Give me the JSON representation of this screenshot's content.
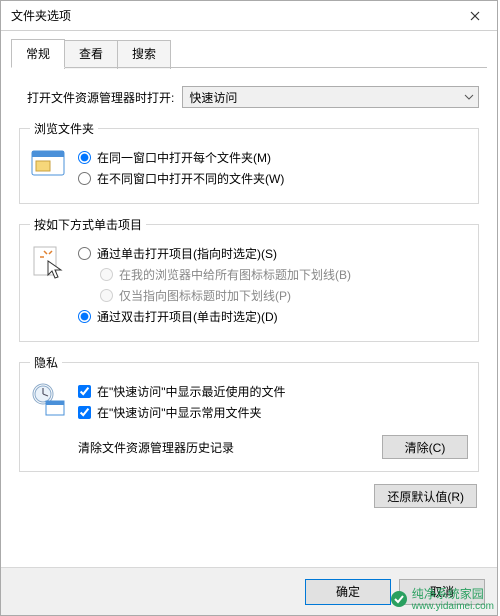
{
  "window": {
    "title": "文件夹选项"
  },
  "tabs": {
    "items": [
      "常规",
      "查看",
      "搜索"
    ],
    "active": 0
  },
  "open_row": {
    "label": "打开文件资源管理器时打开:",
    "value": "快速访问"
  },
  "browse_group": {
    "legend": "浏览文件夹",
    "opt1": "在同一窗口中打开每个文件夹(M)",
    "opt2": "在不同窗口中打开不同的文件夹(W)",
    "selected": 0
  },
  "click_group": {
    "legend": "按如下方式单击项目",
    "opt1": "通过单击打开项目(指向时选定)(S)",
    "opt1a": "在我的浏览器中给所有图标标题加下划线(B)",
    "opt1b": "仅当指向图标标题时加下划线(P)",
    "opt2": "通过双击打开项目(单击时选定)(D)",
    "selected": 1
  },
  "privacy_group": {
    "legend": "隐私",
    "chk1": "在\"快速访问\"中显示最近使用的文件",
    "chk2": "在\"快速访问\"中显示常用文件夹",
    "chk1_checked": true,
    "chk2_checked": true,
    "clear_label": "清除文件资源管理器历史记录",
    "clear_btn": "清除(C)"
  },
  "restore_btn": "还原默认值(R)",
  "buttons": {
    "ok": "确定",
    "cancel": "取消"
  },
  "watermark": {
    "line1": "纯净系统家园",
    "line2": "www.yidaimei.com"
  }
}
